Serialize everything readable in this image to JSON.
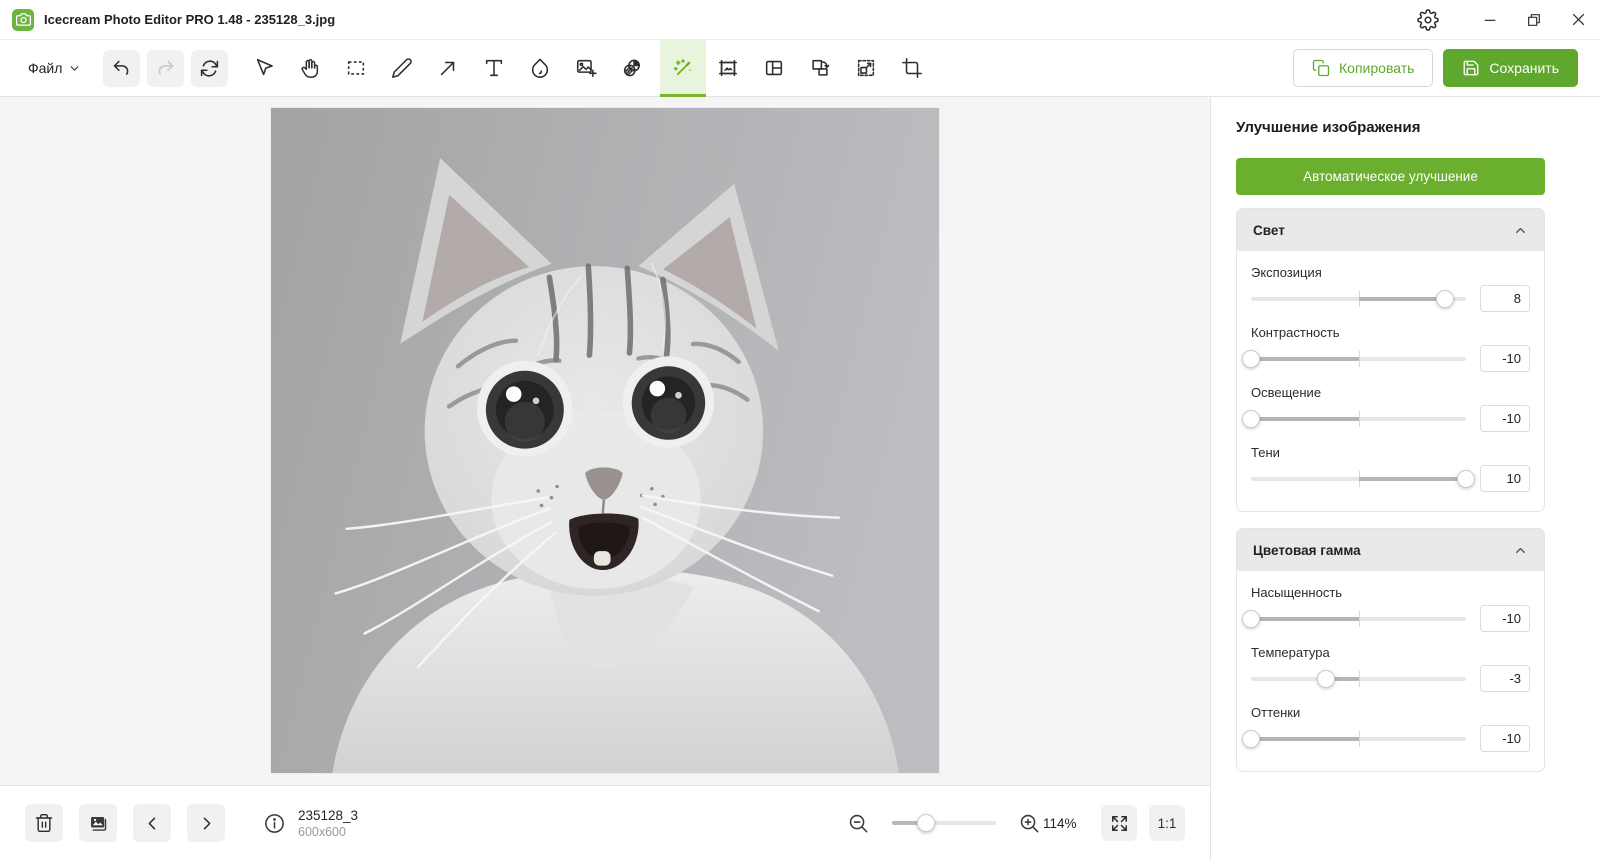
{
  "window": {
    "title": "Icecream Photo Editor PRO 1.48 - 235128_3.jpg",
    "app_icon": "camera-icon",
    "control_icons": [
      "settings-gear-icon",
      "minimize-icon",
      "restore-icon",
      "close-icon"
    ]
  },
  "menubar": {
    "file_label": "Файл"
  },
  "toolbar": {
    "tools": [
      "undo",
      "redo",
      "rotate",
      "cursor",
      "hand",
      "select-area",
      "pencil",
      "arrow",
      "text",
      "blur-drop",
      "add-image",
      "filters",
      "magic-wand",
      "frame",
      "collage",
      "flip-rotate",
      "resize",
      "crop"
    ],
    "active_tool": "magic-wand",
    "disabled_tools": [
      "redo"
    ]
  },
  "header_actions": {
    "copy_label": "Копировать",
    "save_label": "Сохранить"
  },
  "side_panel": {
    "title": "Улучшение изображения",
    "auto_enhance_label": "Автоматическое улучшение",
    "slider_min": -10,
    "slider_max": 10,
    "sections": [
      {
        "title": "Свет",
        "collapsed": false,
        "sliders": [
          {
            "label": "Экспозиция",
            "value": 8
          },
          {
            "label": "Контрастность",
            "value": -10
          },
          {
            "label": "Освещение",
            "value": -10
          },
          {
            "label": "Тени",
            "value": 10
          }
        ]
      },
      {
        "title": "Цветовая гамма",
        "collapsed": false,
        "sliders": [
          {
            "label": "Насыщенность",
            "value": -10
          },
          {
            "label": "Температура",
            "value": -3
          },
          {
            "label": "Оттенки",
            "value": -10
          }
        ]
      }
    ]
  },
  "canvas": {
    "image_description": "surprised-gray-cat-photo"
  },
  "status_bar": {
    "left_icons": [
      "trash-icon",
      "gallery-icon",
      "prev-arrow-icon",
      "next-arrow-icon",
      "info-icon"
    ],
    "filename": "235128_3",
    "image_dimensions": "600x600",
    "zoom_slider_percent": 33,
    "zoom_level": "114%",
    "actual_size_label": "1:1"
  },
  "colors": {
    "accent_green": "#5fa82d",
    "accent_green_light": "#e9f4dd",
    "active_underline": "#76b82a",
    "section_header_bg": "#e9e9e9",
    "button_gray_bg": "#f1f1f1",
    "canvas_bg": "#f5f5f6"
  }
}
